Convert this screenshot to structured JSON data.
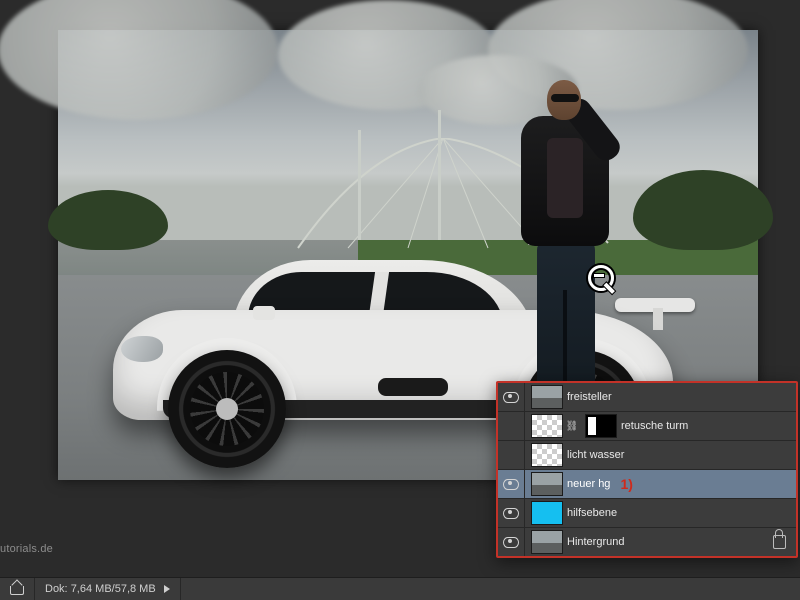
{
  "statusbar": {
    "watermark": "utorials.de",
    "doc_label": "Dok:",
    "doc_size": "7,64 MB/57,8 MB"
  },
  "layers_panel": {
    "annotation": "1)",
    "layers": [
      {
        "name": "freisteller",
        "visible": true,
        "thumb": "photo",
        "mask": "",
        "selected": false,
        "locked": false
      },
      {
        "name": "retusche turm",
        "visible": false,
        "thumb": "checker",
        "mask": "mask",
        "selected": false,
        "locked": false
      },
      {
        "name": "licht wasser",
        "visible": false,
        "thumb": "checker",
        "mask": "",
        "selected": false,
        "locked": false
      },
      {
        "name": "neuer hg",
        "visible": true,
        "thumb": "photo",
        "mask": "",
        "selected": true,
        "locked": false
      },
      {
        "name": "hilfsebene",
        "visible": true,
        "thumb": "blue",
        "mask": "",
        "selected": false,
        "locked": false
      },
      {
        "name": "Hintergrund",
        "visible": true,
        "thumb": "photo",
        "mask": "",
        "selected": false,
        "locked": true
      }
    ]
  },
  "cursor": {
    "type": "zoom-out"
  }
}
